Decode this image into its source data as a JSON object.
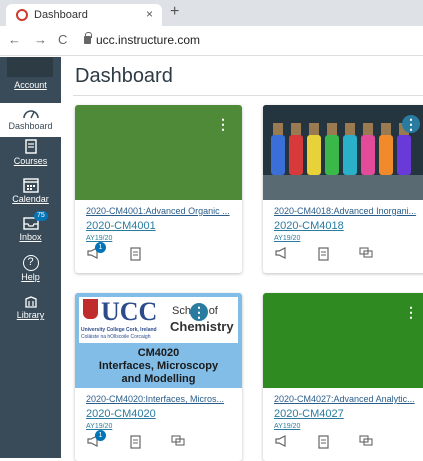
{
  "browser": {
    "tab_title": "Dashboard",
    "tab_close": "×",
    "new_tab": "+",
    "url": "ucc.instructure.com",
    "back": "←",
    "forward": "→",
    "reload": "C"
  },
  "sidebar": {
    "items": [
      {
        "label": "Account",
        "icon": "account-icon"
      },
      {
        "label": "Dashboard",
        "icon": "dashboard-icon",
        "active": true
      },
      {
        "label": "Courses",
        "icon": "courses-icon"
      },
      {
        "label": "Calendar",
        "icon": "calendar-icon"
      },
      {
        "label": "Inbox",
        "icon": "inbox-icon",
        "badge": "75"
      },
      {
        "label": "Help",
        "icon": "help-icon",
        "glyph": "?"
      },
      {
        "label": "Library",
        "icon": "library-icon"
      }
    ]
  },
  "main": {
    "title": "Dashboard"
  },
  "cards": [
    {
      "name": "2020-CM4001:Advanced Organic ...",
      "code": "2020-CM4001",
      "term": "AY19/20",
      "hero_color": "#4f8a38",
      "announcement_badge": "1"
    },
    {
      "name": "2020-CM4018:Advanced Inorgani...",
      "code": "2020-CM4018",
      "term": "AY19/20",
      "hero_image": "colored-bottles"
    },
    {
      "name": "2020-CM4020:Interfaces, Micros...",
      "code": "2020-CM4020",
      "term": "AY19/20",
      "announcement_badge": "1",
      "hero": {
        "logo_text": "UCC",
        "logo_sub1": "University College Cork, Ireland",
        "logo_sub2": "Coláiste na hOllscoile Corcaigh",
        "school": "School of",
        "chemistry": "Chemistry",
        "line1": "CM4020",
        "line2": "Interfaces, Microscopy",
        "line3": "and Modelling"
      }
    },
    {
      "name": "2020-CM4027:Advanced Analytic...",
      "code": "2020-CM4027",
      "term": "AY19/20",
      "hero_color": "#2f8a22"
    }
  ],
  "colors": {
    "sidebar_bg": "#394b58",
    "link": "#2a7ba0",
    "badge": "#0374b5"
  }
}
